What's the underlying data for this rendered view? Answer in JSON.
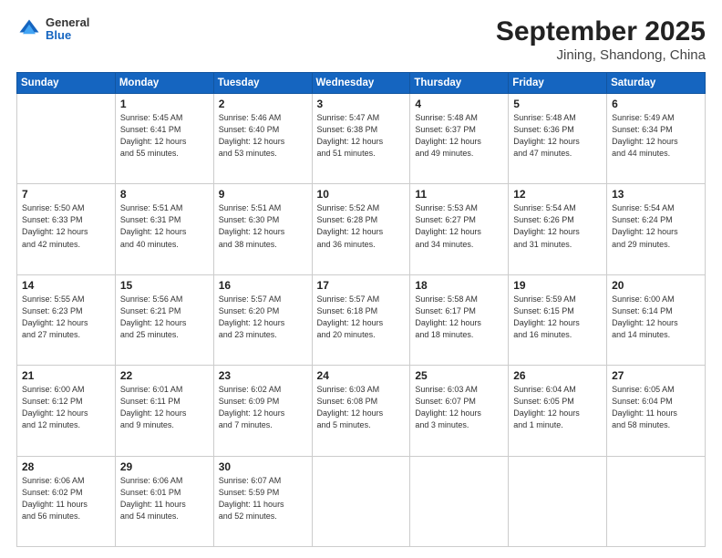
{
  "header": {
    "logo": {
      "general": "General",
      "blue": "Blue"
    },
    "title": "September 2025",
    "subtitle": "Jining, Shandong, China"
  },
  "weekdays": [
    "Sunday",
    "Monday",
    "Tuesday",
    "Wednesday",
    "Thursday",
    "Friday",
    "Saturday"
  ],
  "weeks": [
    [
      {
        "day": "",
        "info": ""
      },
      {
        "day": "1",
        "info": "Sunrise: 5:45 AM\nSunset: 6:41 PM\nDaylight: 12 hours\nand 55 minutes."
      },
      {
        "day": "2",
        "info": "Sunrise: 5:46 AM\nSunset: 6:40 PM\nDaylight: 12 hours\nand 53 minutes."
      },
      {
        "day": "3",
        "info": "Sunrise: 5:47 AM\nSunset: 6:38 PM\nDaylight: 12 hours\nand 51 minutes."
      },
      {
        "day": "4",
        "info": "Sunrise: 5:48 AM\nSunset: 6:37 PM\nDaylight: 12 hours\nand 49 minutes."
      },
      {
        "day": "5",
        "info": "Sunrise: 5:48 AM\nSunset: 6:36 PM\nDaylight: 12 hours\nand 47 minutes."
      },
      {
        "day": "6",
        "info": "Sunrise: 5:49 AM\nSunset: 6:34 PM\nDaylight: 12 hours\nand 44 minutes."
      }
    ],
    [
      {
        "day": "7",
        "info": "Sunrise: 5:50 AM\nSunset: 6:33 PM\nDaylight: 12 hours\nand 42 minutes."
      },
      {
        "day": "8",
        "info": "Sunrise: 5:51 AM\nSunset: 6:31 PM\nDaylight: 12 hours\nand 40 minutes."
      },
      {
        "day": "9",
        "info": "Sunrise: 5:51 AM\nSunset: 6:30 PM\nDaylight: 12 hours\nand 38 minutes."
      },
      {
        "day": "10",
        "info": "Sunrise: 5:52 AM\nSunset: 6:28 PM\nDaylight: 12 hours\nand 36 minutes."
      },
      {
        "day": "11",
        "info": "Sunrise: 5:53 AM\nSunset: 6:27 PM\nDaylight: 12 hours\nand 34 minutes."
      },
      {
        "day": "12",
        "info": "Sunrise: 5:54 AM\nSunset: 6:26 PM\nDaylight: 12 hours\nand 31 minutes."
      },
      {
        "day": "13",
        "info": "Sunrise: 5:54 AM\nSunset: 6:24 PM\nDaylight: 12 hours\nand 29 minutes."
      }
    ],
    [
      {
        "day": "14",
        "info": "Sunrise: 5:55 AM\nSunset: 6:23 PM\nDaylight: 12 hours\nand 27 minutes."
      },
      {
        "day": "15",
        "info": "Sunrise: 5:56 AM\nSunset: 6:21 PM\nDaylight: 12 hours\nand 25 minutes."
      },
      {
        "day": "16",
        "info": "Sunrise: 5:57 AM\nSunset: 6:20 PM\nDaylight: 12 hours\nand 23 minutes."
      },
      {
        "day": "17",
        "info": "Sunrise: 5:57 AM\nSunset: 6:18 PM\nDaylight: 12 hours\nand 20 minutes."
      },
      {
        "day": "18",
        "info": "Sunrise: 5:58 AM\nSunset: 6:17 PM\nDaylight: 12 hours\nand 18 minutes."
      },
      {
        "day": "19",
        "info": "Sunrise: 5:59 AM\nSunset: 6:15 PM\nDaylight: 12 hours\nand 16 minutes."
      },
      {
        "day": "20",
        "info": "Sunrise: 6:00 AM\nSunset: 6:14 PM\nDaylight: 12 hours\nand 14 minutes."
      }
    ],
    [
      {
        "day": "21",
        "info": "Sunrise: 6:00 AM\nSunset: 6:12 PM\nDaylight: 12 hours\nand 12 minutes."
      },
      {
        "day": "22",
        "info": "Sunrise: 6:01 AM\nSunset: 6:11 PM\nDaylight: 12 hours\nand 9 minutes."
      },
      {
        "day": "23",
        "info": "Sunrise: 6:02 AM\nSunset: 6:09 PM\nDaylight: 12 hours\nand 7 minutes."
      },
      {
        "day": "24",
        "info": "Sunrise: 6:03 AM\nSunset: 6:08 PM\nDaylight: 12 hours\nand 5 minutes."
      },
      {
        "day": "25",
        "info": "Sunrise: 6:03 AM\nSunset: 6:07 PM\nDaylight: 12 hours\nand 3 minutes."
      },
      {
        "day": "26",
        "info": "Sunrise: 6:04 AM\nSunset: 6:05 PM\nDaylight: 12 hours\nand 1 minute."
      },
      {
        "day": "27",
        "info": "Sunrise: 6:05 AM\nSunset: 6:04 PM\nDaylight: 11 hours\nand 58 minutes."
      }
    ],
    [
      {
        "day": "28",
        "info": "Sunrise: 6:06 AM\nSunset: 6:02 PM\nDaylight: 11 hours\nand 56 minutes."
      },
      {
        "day": "29",
        "info": "Sunrise: 6:06 AM\nSunset: 6:01 PM\nDaylight: 11 hours\nand 54 minutes."
      },
      {
        "day": "30",
        "info": "Sunrise: 6:07 AM\nSunset: 5:59 PM\nDaylight: 11 hours\nand 52 minutes."
      },
      {
        "day": "",
        "info": ""
      },
      {
        "day": "",
        "info": ""
      },
      {
        "day": "",
        "info": ""
      },
      {
        "day": "",
        "info": ""
      }
    ]
  ]
}
